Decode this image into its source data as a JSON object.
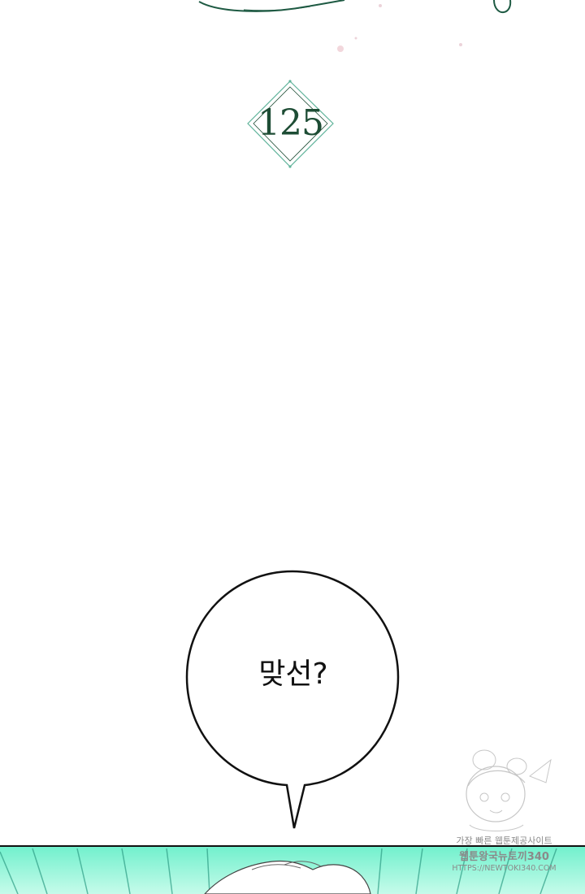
{
  "chapter": {
    "number": "125",
    "accent_color": "#1e4d35",
    "border_color": "#5fb39a"
  },
  "speech": {
    "text": "맞선?"
  },
  "bottom_panel": {
    "colors": [
      "#6ff0cc",
      "#9ff7de",
      "#c6fbea"
    ]
  },
  "watermark": {
    "line1": "가장 빠른 웹툰제공사이트",
    "line2": "웹툰왕국뉴토끼340",
    "line3": "HTTPS://NEWTOKI340.COM"
  }
}
